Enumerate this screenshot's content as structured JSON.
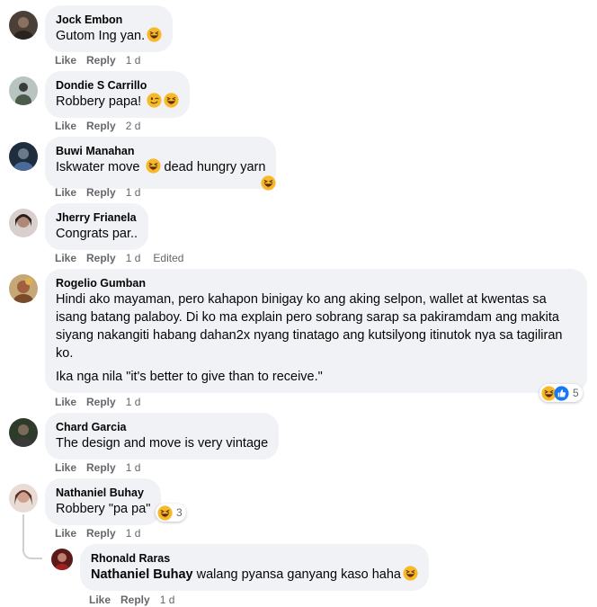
{
  "actions": {
    "like": "Like",
    "reply": "Reply"
  },
  "comments": [
    {
      "author": "Jock Embon",
      "text": "Gutom Ing yan.",
      "time": "1 d",
      "emoji": "laughing-face"
    },
    {
      "author": "Dondie S Carrillo",
      "text": "Robbery papa!",
      "time": "2 d",
      "emoji": [
        "winking-face",
        "laughing-face"
      ]
    },
    {
      "author": "Buwi Manahan",
      "text_a": "Iskwater move",
      "text_b": "dead hungry yarn",
      "time": "1 d",
      "emoji": "laughing-face"
    },
    {
      "author": "Jherry Frianela",
      "text": "Congrats par..",
      "time": "1 d",
      "edited": "Edited"
    },
    {
      "author": "Rogelio Gumban",
      "text_p1": "Hindi ako mayaman, pero kahapon binigay ko ang aking selpon, wallet at kwentas sa isang batang palaboy. Di ko ma explain pero sobrang sarap sa pakiramdam ang makita siyang nakangiti habang dahan2x nyang tinatago ang kutsilyong itinutok nya sa tagiliran ko.",
      "text_p2": "Ika nga nila \"it's better to give than to receive.\"",
      "time": "1 d",
      "reaction_icons": [
        "haha-reaction-icon",
        "like-reaction-icon"
      ],
      "reaction_count": "5"
    },
    {
      "author": "Chard Garcia",
      "text": "The design and move is very vintage",
      "time": "1 d"
    },
    {
      "author": "Nathaniel Buhay",
      "text": "Robbery \"pa pa\"",
      "time": "1 d",
      "reaction_icons": [
        "haha-reaction-icon"
      ],
      "reaction_count": "3"
    },
    {
      "author": "Rhonald Raras",
      "mention": "Nathaniel Buhay",
      "text": " walang pyansa ganyang kaso haha",
      "time": "1 d",
      "emoji": "laughing-face",
      "is_reply": true
    }
  ],
  "colors": {
    "bubble": "#f0f2f5",
    "meta": "#65676b",
    "like_blue": "#1877f2",
    "haha_yellow": "#f7b125"
  }
}
